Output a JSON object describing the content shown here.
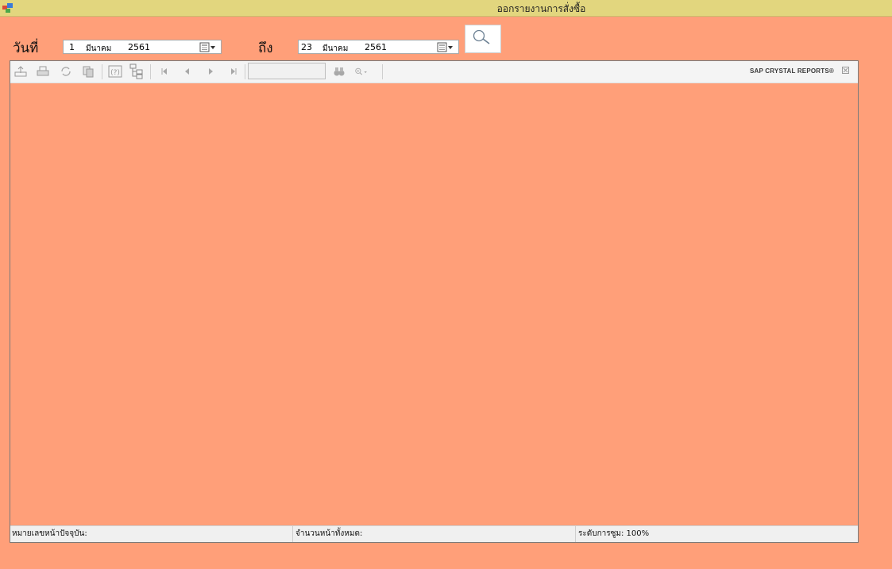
{
  "window": {
    "title": "ออกรายงานการสั่งซื้อ"
  },
  "filters": {
    "from_label": "วันที่",
    "to_label": "ถึง",
    "start_date": {
      "day": "1",
      "month": "มีนาคม",
      "year": "2561"
    },
    "end_date": {
      "day": "23",
      "month": "มีนาคม",
      "year": "2561"
    }
  },
  "viewer": {
    "brand": "SAP CRYSTAL REPORTS®",
    "page_input_value": "",
    "status": {
      "current_page_label": "หมายเลขหน้าปัจจุบัน:",
      "total_pages_label": "จำนวนหน้าทั้งหมด:",
      "zoom_label": "ระดับการซูม: 100%"
    }
  },
  "colors": {
    "background": "#ff9f79",
    "titlebar": "#e2d67e"
  }
}
